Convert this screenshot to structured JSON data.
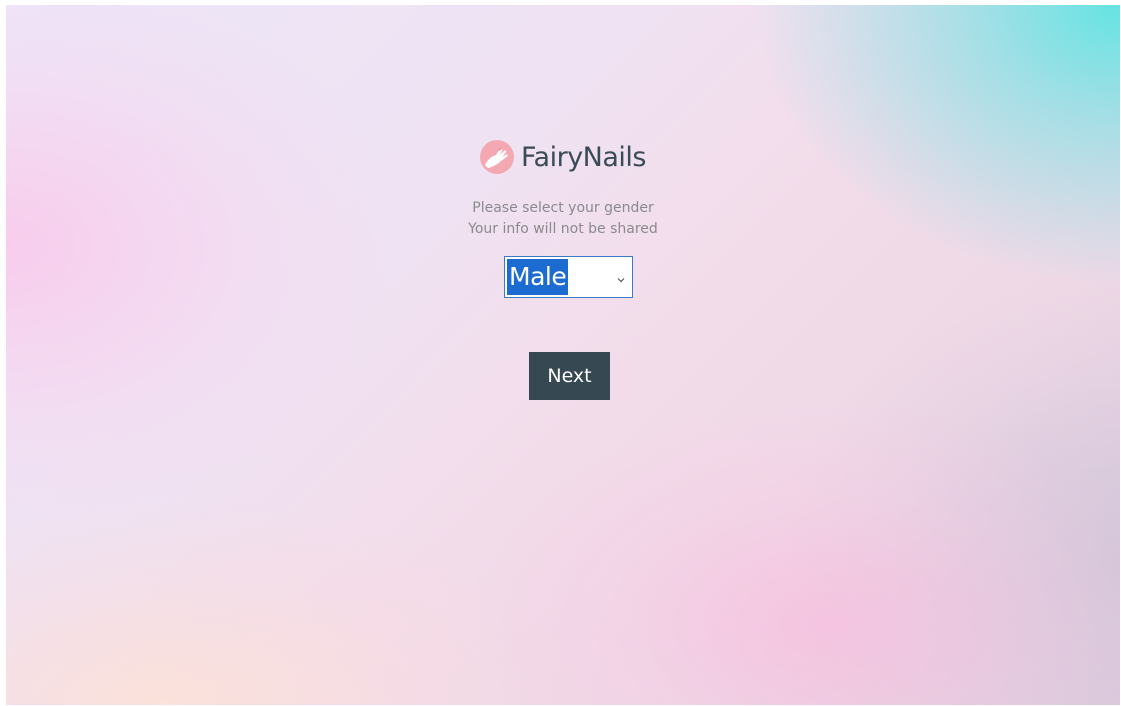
{
  "app": {
    "name": "FairyNails",
    "logo_icon": "nail-polish-hand-icon"
  },
  "form": {
    "prompt_line1": "Please select your gender",
    "prompt_line2": "Your info will not be shared",
    "gender_select": {
      "selected": "Male",
      "icon": "chevron-down-icon"
    },
    "next_label": "Next"
  },
  "colors": {
    "brand_text": "#394b56",
    "button_bg": "#364852",
    "selection_highlight": "#1c6bd0",
    "subtitle_text": "#8a8a8e"
  }
}
